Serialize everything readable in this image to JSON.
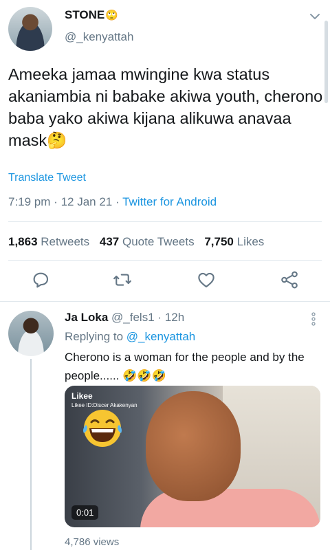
{
  "tweet": {
    "author_name": "STONE",
    "author_emoji": "🙄",
    "handle": "@_kenyattah",
    "text": "Ameeka jamaa mwingine kwa status akaniambia ni babake akiwa youth, cherono baba yako akiwa kijana alikuwa anavaa mask🤔",
    "translate_label": "Translate Tweet",
    "time": "7:19 pm",
    "date": "12 Jan 21",
    "client": "Twitter for Android",
    "retweets": {
      "count": "1,863",
      "label": "Retweets"
    },
    "quote_tweets": {
      "count": "437",
      "label": "Quote Tweets"
    },
    "likes": {
      "count": "7,750",
      "label": "Likes"
    },
    "icons": [
      "reply-icon",
      "retweet-icon",
      "like-icon",
      "share-icon",
      "chevron-down-icon"
    ]
  },
  "reply": {
    "name": "Ja Loka",
    "handle": "@_fels1",
    "time": "12h",
    "replying_to_label": "Replying to",
    "replying_to_handle": "@_kenyattah",
    "text": "Cherono is a woman for the people and by the people...... 🤣🤣🤣",
    "video": {
      "watermark": "Likee",
      "watermark_tag": "Likee ID:Discer Akakenyan",
      "duration": "0:01"
    },
    "views": "4,786 views"
  },
  "colors": {
    "accent": "#1b95e0",
    "secondary_text": "#657786",
    "primary_text": "#14171a",
    "divider": "#e1e8ed"
  }
}
